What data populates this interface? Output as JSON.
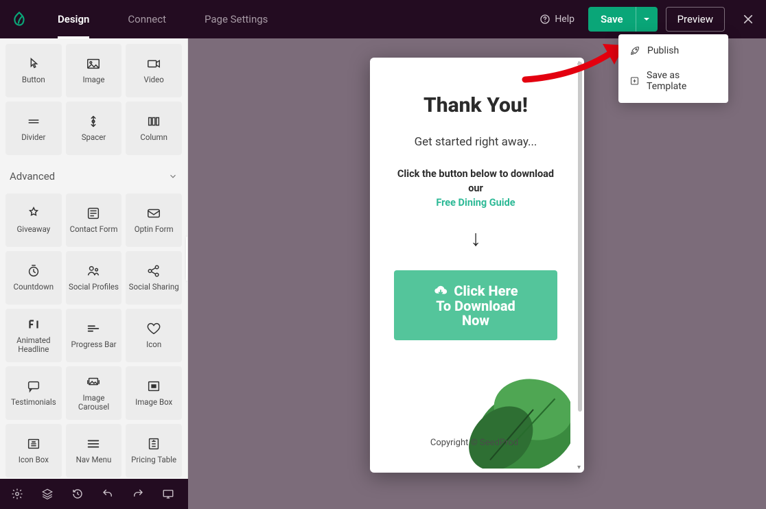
{
  "header": {
    "tabs": [
      "Design",
      "Connect",
      "Page Settings"
    ],
    "help": "Help",
    "save": "Save",
    "preview": "Preview"
  },
  "save_menu": {
    "publish": "Publish",
    "save_template": "Save as Template"
  },
  "sidebar": {
    "basic_blocks": [
      {
        "label": "Button",
        "name": "button"
      },
      {
        "label": "Image",
        "name": "image"
      },
      {
        "label": "Video",
        "name": "video"
      },
      {
        "label": "Divider",
        "name": "divider"
      },
      {
        "label": "Spacer",
        "name": "spacer"
      },
      {
        "label": "Column",
        "name": "column"
      }
    ],
    "advanced_head": "Advanced",
    "advanced_blocks": [
      {
        "label": "Giveaway",
        "name": "giveaway"
      },
      {
        "label": "Contact Form",
        "name": "contact-form"
      },
      {
        "label": "Optin Form",
        "name": "optin-form"
      },
      {
        "label": "Countdown",
        "name": "countdown"
      },
      {
        "label": "Social Profiles",
        "name": "social-profiles"
      },
      {
        "label": "Social Sharing",
        "name": "social-sharing"
      },
      {
        "label": "Animated Headline",
        "name": "animated-headline"
      },
      {
        "label": "Progress Bar",
        "name": "progress-bar"
      },
      {
        "label": "Icon",
        "name": "icon"
      },
      {
        "label": "Testimonials",
        "name": "testimonials"
      },
      {
        "label": "Image Carousel",
        "name": "image-carousel"
      },
      {
        "label": "Image Box",
        "name": "image-box"
      },
      {
        "label": "Icon Box",
        "name": "icon-box"
      },
      {
        "label": "Nav Menu",
        "name": "nav-menu"
      },
      {
        "label": "Pricing Table",
        "name": "pricing-table"
      }
    ]
  },
  "preview_page": {
    "title": "Thank You!",
    "subtitle": "Get started right away...",
    "instruction_line1": "Click the button below to download our",
    "guide_link": "Free Dining Guide",
    "arrow": "↓",
    "cta_line1": "Click Here",
    "cta_line2": "To Download",
    "cta_line3": "Now",
    "copyright": "Copyright © SeedProd"
  }
}
